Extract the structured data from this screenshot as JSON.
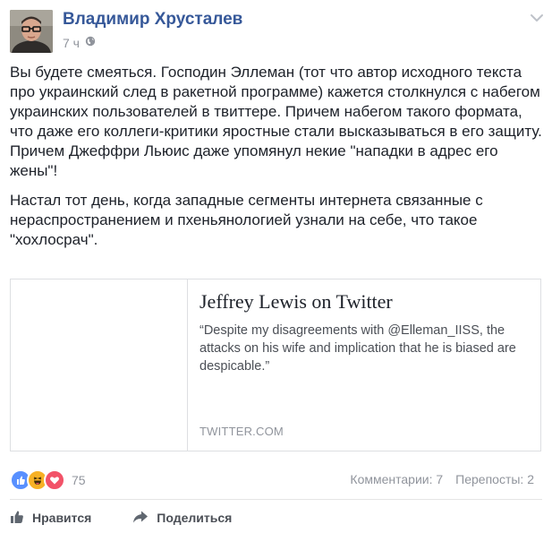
{
  "post": {
    "author": "Владимир Хрусталев",
    "timestamp": "7 ч",
    "audience_icon": "globe-icon",
    "paragraphs": [
      "Вы будете смеяться. Господин Эллеман (тот что автор исходного текста про украинский след в ракетной программе) кажется столкнулся с набегом украинских пользователей в твиттере. Причем набегом такого формата, что даже его коллеги-критики яростные стали высказываться в его защиту. Причем Джеффри Льюис даже упомянул некие \"нападки в адрес его жены\"!",
      "Настал тот день, когда западные сегменты интернета связанные с нераспространением и пхеньянологией узнали на себе, что такое \"хохлосрач\"."
    ]
  },
  "link_card": {
    "title": "Jeffrey Lewis on Twitter",
    "description": "“Despite my disagreements with @Elleman_IISS, the attacks on his wife and implication that he is biased are despicable.”",
    "domain": "TWITTER.COM"
  },
  "reactions": {
    "icons": [
      "like-icon",
      "haha-icon",
      "love-icon"
    ],
    "count": "75",
    "comments": "Комментарии: 7",
    "shares": "Перепосты: 2"
  },
  "actions": {
    "like_label": "Нравится",
    "share_label": "Поделиться"
  },
  "colors": {
    "author": "#365899",
    "meta": "#90949c",
    "like_blue": "#5890ff",
    "haha_yellow": "#f7b125",
    "love_red": "#f25268"
  }
}
